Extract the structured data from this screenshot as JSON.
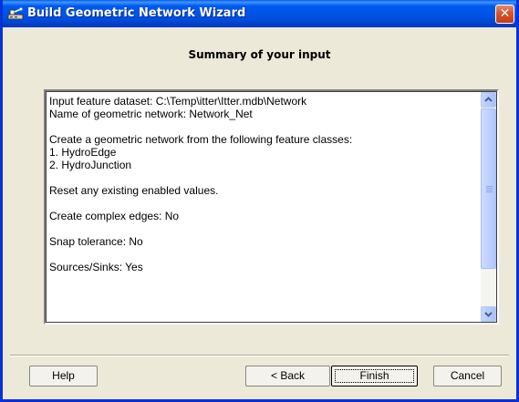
{
  "window": {
    "title": "Build Geometric Network Wizard",
    "close_glyph": "✕"
  },
  "heading": "Summary of your input",
  "summary": {
    "lines": [
      "Input feature dataset: C:\\Temp\\itter\\Itter.mdb\\Network",
      "Name of geometric network: Network_Net",
      "",
      "Create a geometric network from the following feature classes:",
      "1. HydroEdge",
      "2. HydroJunction",
      "",
      "Reset any existing enabled values.",
      "",
      "Create complex edges: No",
      "",
      "Snap tolerance: No",
      "",
      "Sources/Sinks: Yes"
    ]
  },
  "buttons": {
    "help": "Help",
    "back": "< Back",
    "finish": "Finish",
    "cancel": "Cancel"
  },
  "icons": {
    "title": "network-wizard-icon",
    "close": "close-icon",
    "scroll_up": "chevron-up-icon",
    "scroll_down": "chevron-down-icon"
  },
  "colors": {
    "title_bar": "#0054e3",
    "close_button": "#d8532e",
    "face": "#ece9d8",
    "scrollbar_thumb": "#bccffd"
  }
}
